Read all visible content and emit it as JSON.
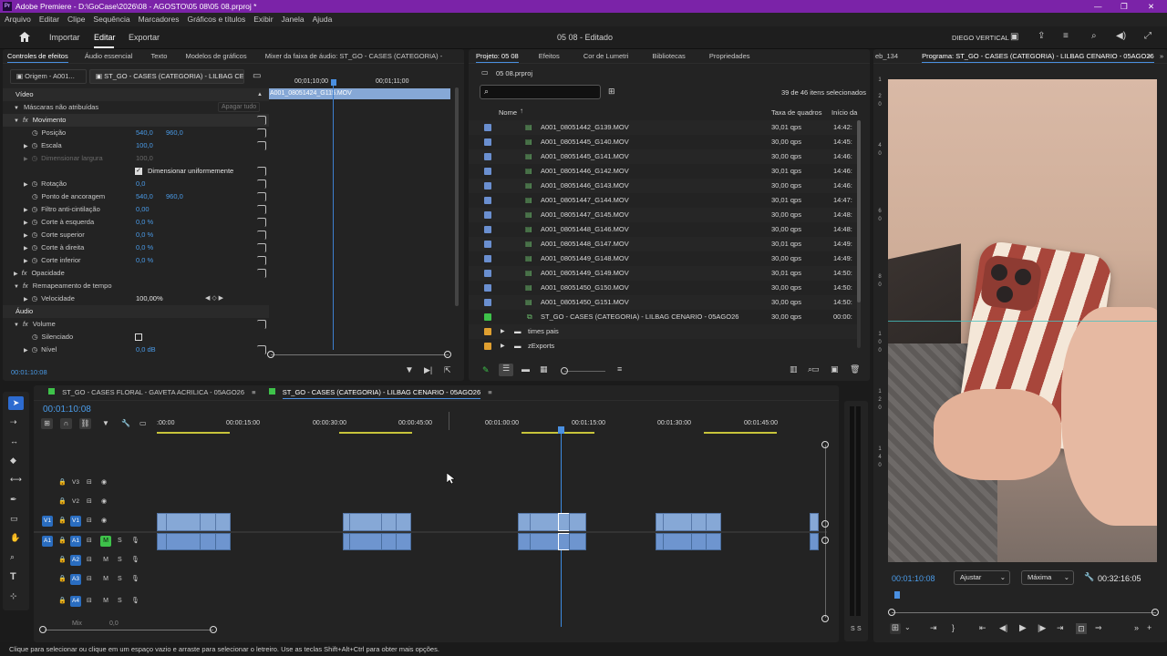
{
  "app": {
    "title": "Adobe Premiere - D:\\GoCase\\2026\\08 - AGOSTO\\05 08\\05 08.prproj *",
    "logo": "Pr"
  },
  "menu": [
    "Arquivo",
    "Editar",
    "Clipe",
    "Sequência",
    "Marcadores",
    "Gráficos e títulos",
    "Exibir",
    "Janela",
    "Ajuda"
  ],
  "workspace": {
    "tabs": [
      "Importar",
      "Editar",
      "Exportar"
    ],
    "active": "Editar",
    "center_title": "05 08 - Editado",
    "preset": "DIEGO VERTICAL"
  },
  "effect_controls": {
    "tabs": [
      "Controles de efeitos",
      "Áudio essencial",
      "Texto",
      "Modelos de gráficos",
      "Mixer da faixa de áudio: ST_GO - CASES (CATEGORIA) -"
    ],
    "source_tab": "Origem - A001...",
    "seq_tab": "ST_GO - CASES (CATEGORIA) - LILBAG CE...",
    "ruler": [
      "00;01;10;00",
      "00;01;11;00"
    ],
    "clip_name": "A001_08051424_G115.MOV",
    "erase_label": "Apagar tudo",
    "timecode": "00:01:10:08",
    "rows": [
      {
        "label": "Vídeo",
        "type": "header"
      },
      {
        "label": "Máscaras não atribuídas",
        "type": "group"
      },
      {
        "label": "Movimento",
        "type": "fx"
      },
      {
        "label": "Posição",
        "v1": "540,0",
        "v2": "960,0"
      },
      {
        "label": "Escala",
        "v1": "100,0"
      },
      {
        "label": "Dimensionar largura",
        "v1": "100,0",
        "disabled": true
      },
      {
        "label": "Dimensionar uniformemente",
        "type": "checkbox"
      },
      {
        "label": "Rotação",
        "v1": "0,0"
      },
      {
        "label": "Ponto de ancoragem",
        "v1": "540,0",
        "v2": "960,0"
      },
      {
        "label": "Filtro anti-cintilação",
        "v1": "0,00"
      },
      {
        "label": "Corte à esquerda",
        "v1": "0,0 %"
      },
      {
        "label": "Corte superior",
        "v1": "0,0 %"
      },
      {
        "label": "Corte à direita",
        "v1": "0,0 %"
      },
      {
        "label": "Corte inferior",
        "v1": "0,0 %"
      },
      {
        "label": "Opacidade",
        "type": "fx"
      },
      {
        "label": "Remapeamento de tempo",
        "type": "fx"
      },
      {
        "label": "Velocidade",
        "v1": "100,00%"
      },
      {
        "label": "Áudio",
        "type": "header"
      },
      {
        "label": "Volume",
        "type": "fx"
      },
      {
        "label": "Silenciado",
        "type": "checkbox2"
      },
      {
        "label": "Nível",
        "v1": "0,0 dB"
      }
    ]
  },
  "project": {
    "tabs": [
      "Projeto: 05 08",
      "Efeitos",
      "Cor de Lumetri",
      "Bibliotecas",
      "Propriedades"
    ],
    "file": "05 08.prproj",
    "count": "39 de 46 itens selecionados",
    "columns": [
      "Nome",
      "Taxa de quadros",
      "Início da"
    ],
    "items": [
      {
        "name": "A001_08051442_G139.MOV",
        "rate": "30,01 qps",
        "start": "14:42:"
      },
      {
        "name": "A001_08051445_G140.MOV",
        "rate": "30,00 qps",
        "start": "14:45:"
      },
      {
        "name": "A001_08051445_G141.MOV",
        "rate": "30,00 qps",
        "start": "14:46:"
      },
      {
        "name": "A001_08051446_G142.MOV",
        "rate": "30,01 qps",
        "start": "14:46:"
      },
      {
        "name": "A001_08051446_G143.MOV",
        "rate": "30,00 qps",
        "start": "14:46:"
      },
      {
        "name": "A001_08051447_G144.MOV",
        "rate": "30,01 qps",
        "start": "14:47:"
      },
      {
        "name": "A001_08051447_G145.MOV",
        "rate": "30,00 qps",
        "start": "14:48:"
      },
      {
        "name": "A001_08051448_G146.MOV",
        "rate": "30,00 qps",
        "start": "14:48:"
      },
      {
        "name": "A001_08051448_G147.MOV",
        "rate": "30,01 qps",
        "start": "14:49:"
      },
      {
        "name": "A001_08051449_G148.MOV",
        "rate": "30,00 qps",
        "start": "14:49:"
      },
      {
        "name": "A001_08051449_G149.MOV",
        "rate": "30,01 qps",
        "start": "14:50:"
      },
      {
        "name": "A001_08051450_G150.MOV",
        "rate": "30,00 qps",
        "start": "14:50:"
      },
      {
        "name": "A001_08051450_G151.MOV",
        "rate": "30,00 qps",
        "start": "14:50:"
      },
      {
        "name": "ST_GO - CASES (CATEGORIA) - LILBAG CENARIO - 05AGO26",
        "rate": "30,00 qps",
        "start": "00:00:"
      }
    ],
    "folders": [
      "times pais",
      "zExports"
    ]
  },
  "program": {
    "tab_left": "eb_134",
    "tab": "Programa: ST_GO - CASES (CATEGORIA) - LILBAG CENARIO - 05AGO26",
    "timecode": "00:01:10:08",
    "fit": "Ajustar",
    "quality": "Máxima",
    "duration": "00:32:16:05"
  },
  "timeline": {
    "tabs": [
      "ST_GO - CASES FLORAL - GAVETA ACRILICA - 05AGO26",
      "ST_GO - CASES (CATEGORIA) - LILBAG CENARIO - 05AGO26"
    ],
    "timecode": "00:01:10:08",
    "ruler": [
      ":00:00",
      "00:00:15:00",
      "00:00:30:00",
      "00:00:45:00",
      "00:01:00:00",
      "00:01:15:00",
      "00:01:30:00",
      "00:01:45:00"
    ],
    "video_tracks": [
      "V3",
      "V2",
      "V1"
    ],
    "audio_tracks": [
      "A1",
      "A2",
      "A3",
      "A4"
    ],
    "mix": "Mix",
    "mix_val": "0,0"
  },
  "status": "Clique para selecionar ou clique em um espaço vazio e arraste para selecionar o letreiro. Use as teclas Shift+Alt+Ctrl para obter mais opções.",
  "colors": {
    "accent": "#2d8ceb",
    "title_bar": "#7b23a8",
    "clip": "#86a8d6",
    "label_blue": "#6a8fd0",
    "label_green": "#3ec24a",
    "label_orange": "#e0a030"
  }
}
